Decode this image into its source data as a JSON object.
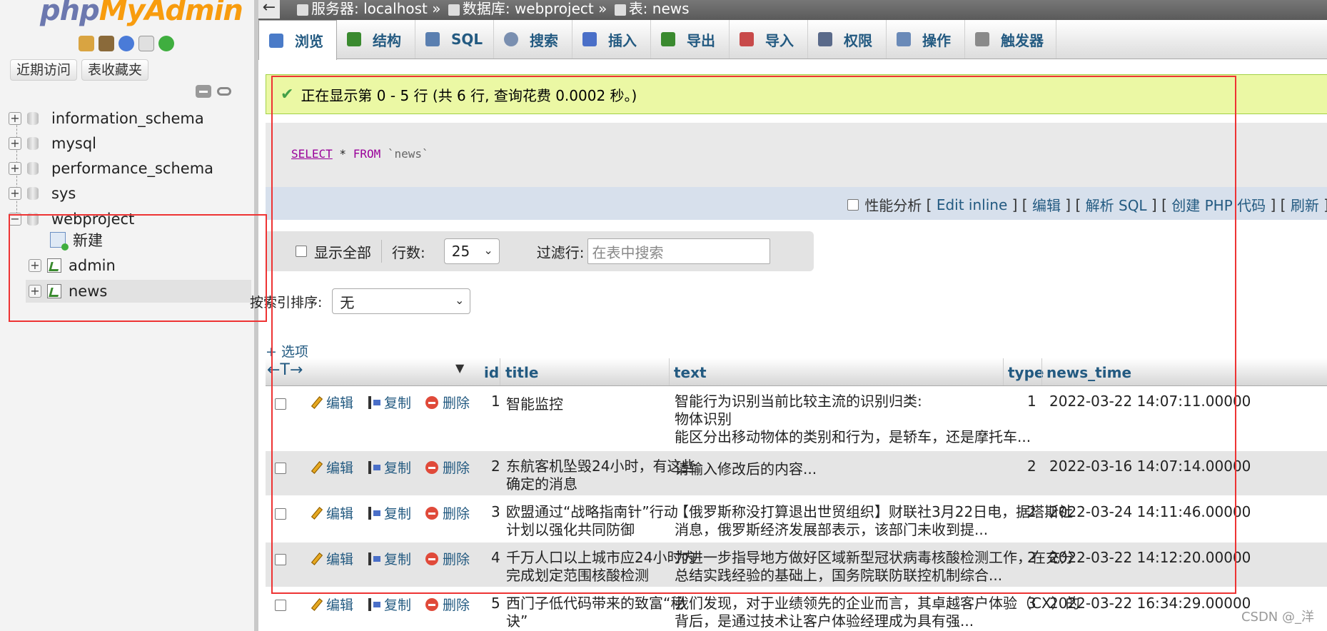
{
  "sidebar": {
    "logo_php": "php",
    "logo_myadmin": "MyAdmin",
    "tab_recent": "近期访问",
    "tab_favorites": "表收藏夹",
    "databases": [
      {
        "name": "information_schema",
        "expander": "+"
      },
      {
        "name": "mysql",
        "expander": "+"
      },
      {
        "name": "performance_schema",
        "expander": "+"
      },
      {
        "name": "sys",
        "expander": "+"
      },
      {
        "name": "webproject",
        "expander": "−"
      }
    ],
    "webproject_children": {
      "new_label": "新建",
      "tables": [
        "admin",
        "news"
      ]
    },
    "header_icons": [
      "home-icon",
      "exit-icon",
      "help-icon",
      "docs-icon",
      "reload-icon"
    ]
  },
  "breadcrumb": {
    "back": "←",
    "server": "服务器: localhost",
    "sep": "»",
    "database": "数据库: webproject",
    "table": "表: news"
  },
  "tabs": [
    {
      "label": "浏览",
      "icon": "browse-icon",
      "color": "#4a7bc8"
    },
    {
      "label": "结构",
      "icon": "structure-icon",
      "color": "#3a8a2f"
    },
    {
      "label": "SQL",
      "icon": "sql-icon",
      "color": "#5a7fb0"
    },
    {
      "label": "搜索",
      "icon": "search-icon",
      "color": "#7a8fb0"
    },
    {
      "label": "插入",
      "icon": "insert-icon",
      "color": "#4a6fc8"
    },
    {
      "label": "导出",
      "icon": "export-icon",
      "color": "#3a8a2f"
    },
    {
      "label": "导入",
      "icon": "import-icon",
      "color": "#c84a4a"
    },
    {
      "label": "权限",
      "icon": "privileges-icon",
      "color": "#5a6a8a"
    },
    {
      "label": "操作",
      "icon": "operations-icon",
      "color": "#6a8ab8"
    },
    {
      "label": "触发器",
      "icon": "triggers-icon",
      "color": "#8a8a8a"
    }
  ],
  "message": "正在显示第 0 - 5 行 (共 6 行, 查询花费 0.0002 秒。)",
  "sql": {
    "select": "SELECT",
    "star": " * ",
    "from": "FROM",
    "table": " `news`"
  },
  "sql_actions": {
    "profiling": "性能分析",
    "edit_inline": "Edit inline",
    "edit": "编辑",
    "parse_sql": "解析 SQL",
    "create_php": "创建 PHP 代码",
    "refresh": "刷新"
  },
  "nav": {
    "show_all": "显示全部",
    "rows_label": "行数:",
    "rows_value": "25",
    "filter_label": "过滤行:",
    "filter_placeholder": "在表中搜索"
  },
  "sort": {
    "label": "按索引排序:",
    "value": "无"
  },
  "options_link": "+ 选项",
  "table": {
    "columns": [
      "id",
      "title",
      "text",
      "type",
      "news_time"
    ],
    "action_labels": {
      "edit": "编辑",
      "copy": "复制",
      "delete": "删除"
    },
    "rows": [
      {
        "id": "1",
        "title_1": "智能监控",
        "title_2": "",
        "text_1": "智能行为识别当前比较主流的识别归类:",
        "text_2": "物体识别",
        "text_3": "能区分出移动物体的类别和行为，是轿车，还是摩托车...",
        "type": "1",
        "news_time": "2022-03-22 14:07:11.00000"
      },
      {
        "id": "2",
        "title_1": "东航客机坠毁24小时，有这些",
        "title_2": "确定的消息",
        "text_1": "请输入修改后的内容...",
        "text_2": "",
        "text_3": "",
        "type": "2",
        "news_time": "2022-03-16 14:07:14.00000"
      },
      {
        "id": "3",
        "title_1": "欧盟通过“战略指南针”行动",
        "title_2": "计划以强化共同防御",
        "text_1": "【俄罗斯称没打算退出世贸组织】财联社3月22日电，据塔斯社",
        "text_2": "消息，俄罗斯经济发展部表示，该部门未收到提...",
        "text_3": "",
        "type": "2",
        "news_time": "2022-03-24 14:11:46.00000"
      },
      {
        "id": "4",
        "title_1": "千万人口以上城市应24小时内",
        "title_2": "完成划定范围核酸检测",
        "text_1": "为进一步指导地方做好区域新型冠状病毒核酸检测工作，在充分",
        "text_2": "总结实践经验的基础上，国务院联防联控机制综合...",
        "text_3": "",
        "type": "2",
        "news_time": "2022-03-22 14:12:20.00000"
      },
      {
        "id": "5",
        "title_1": "西门子低代码带来的致富“秘",
        "title_2": "诀”",
        "text_1": "我们发现，对于业绩领先的企业而言，其卓越客户体验（CX）的",
        "text_2": "背后，是通过技术让客户体验经理成为具有强...",
        "text_3": "",
        "type": "3",
        "news_time": "2022-03-22 16:34:29.00000"
      }
    ]
  },
  "watermark": "CSDN @_洋",
  "colors": {
    "accent": "#235a81",
    "success_bg": "#ebf8a4",
    "annotation": "#ee3333"
  }
}
